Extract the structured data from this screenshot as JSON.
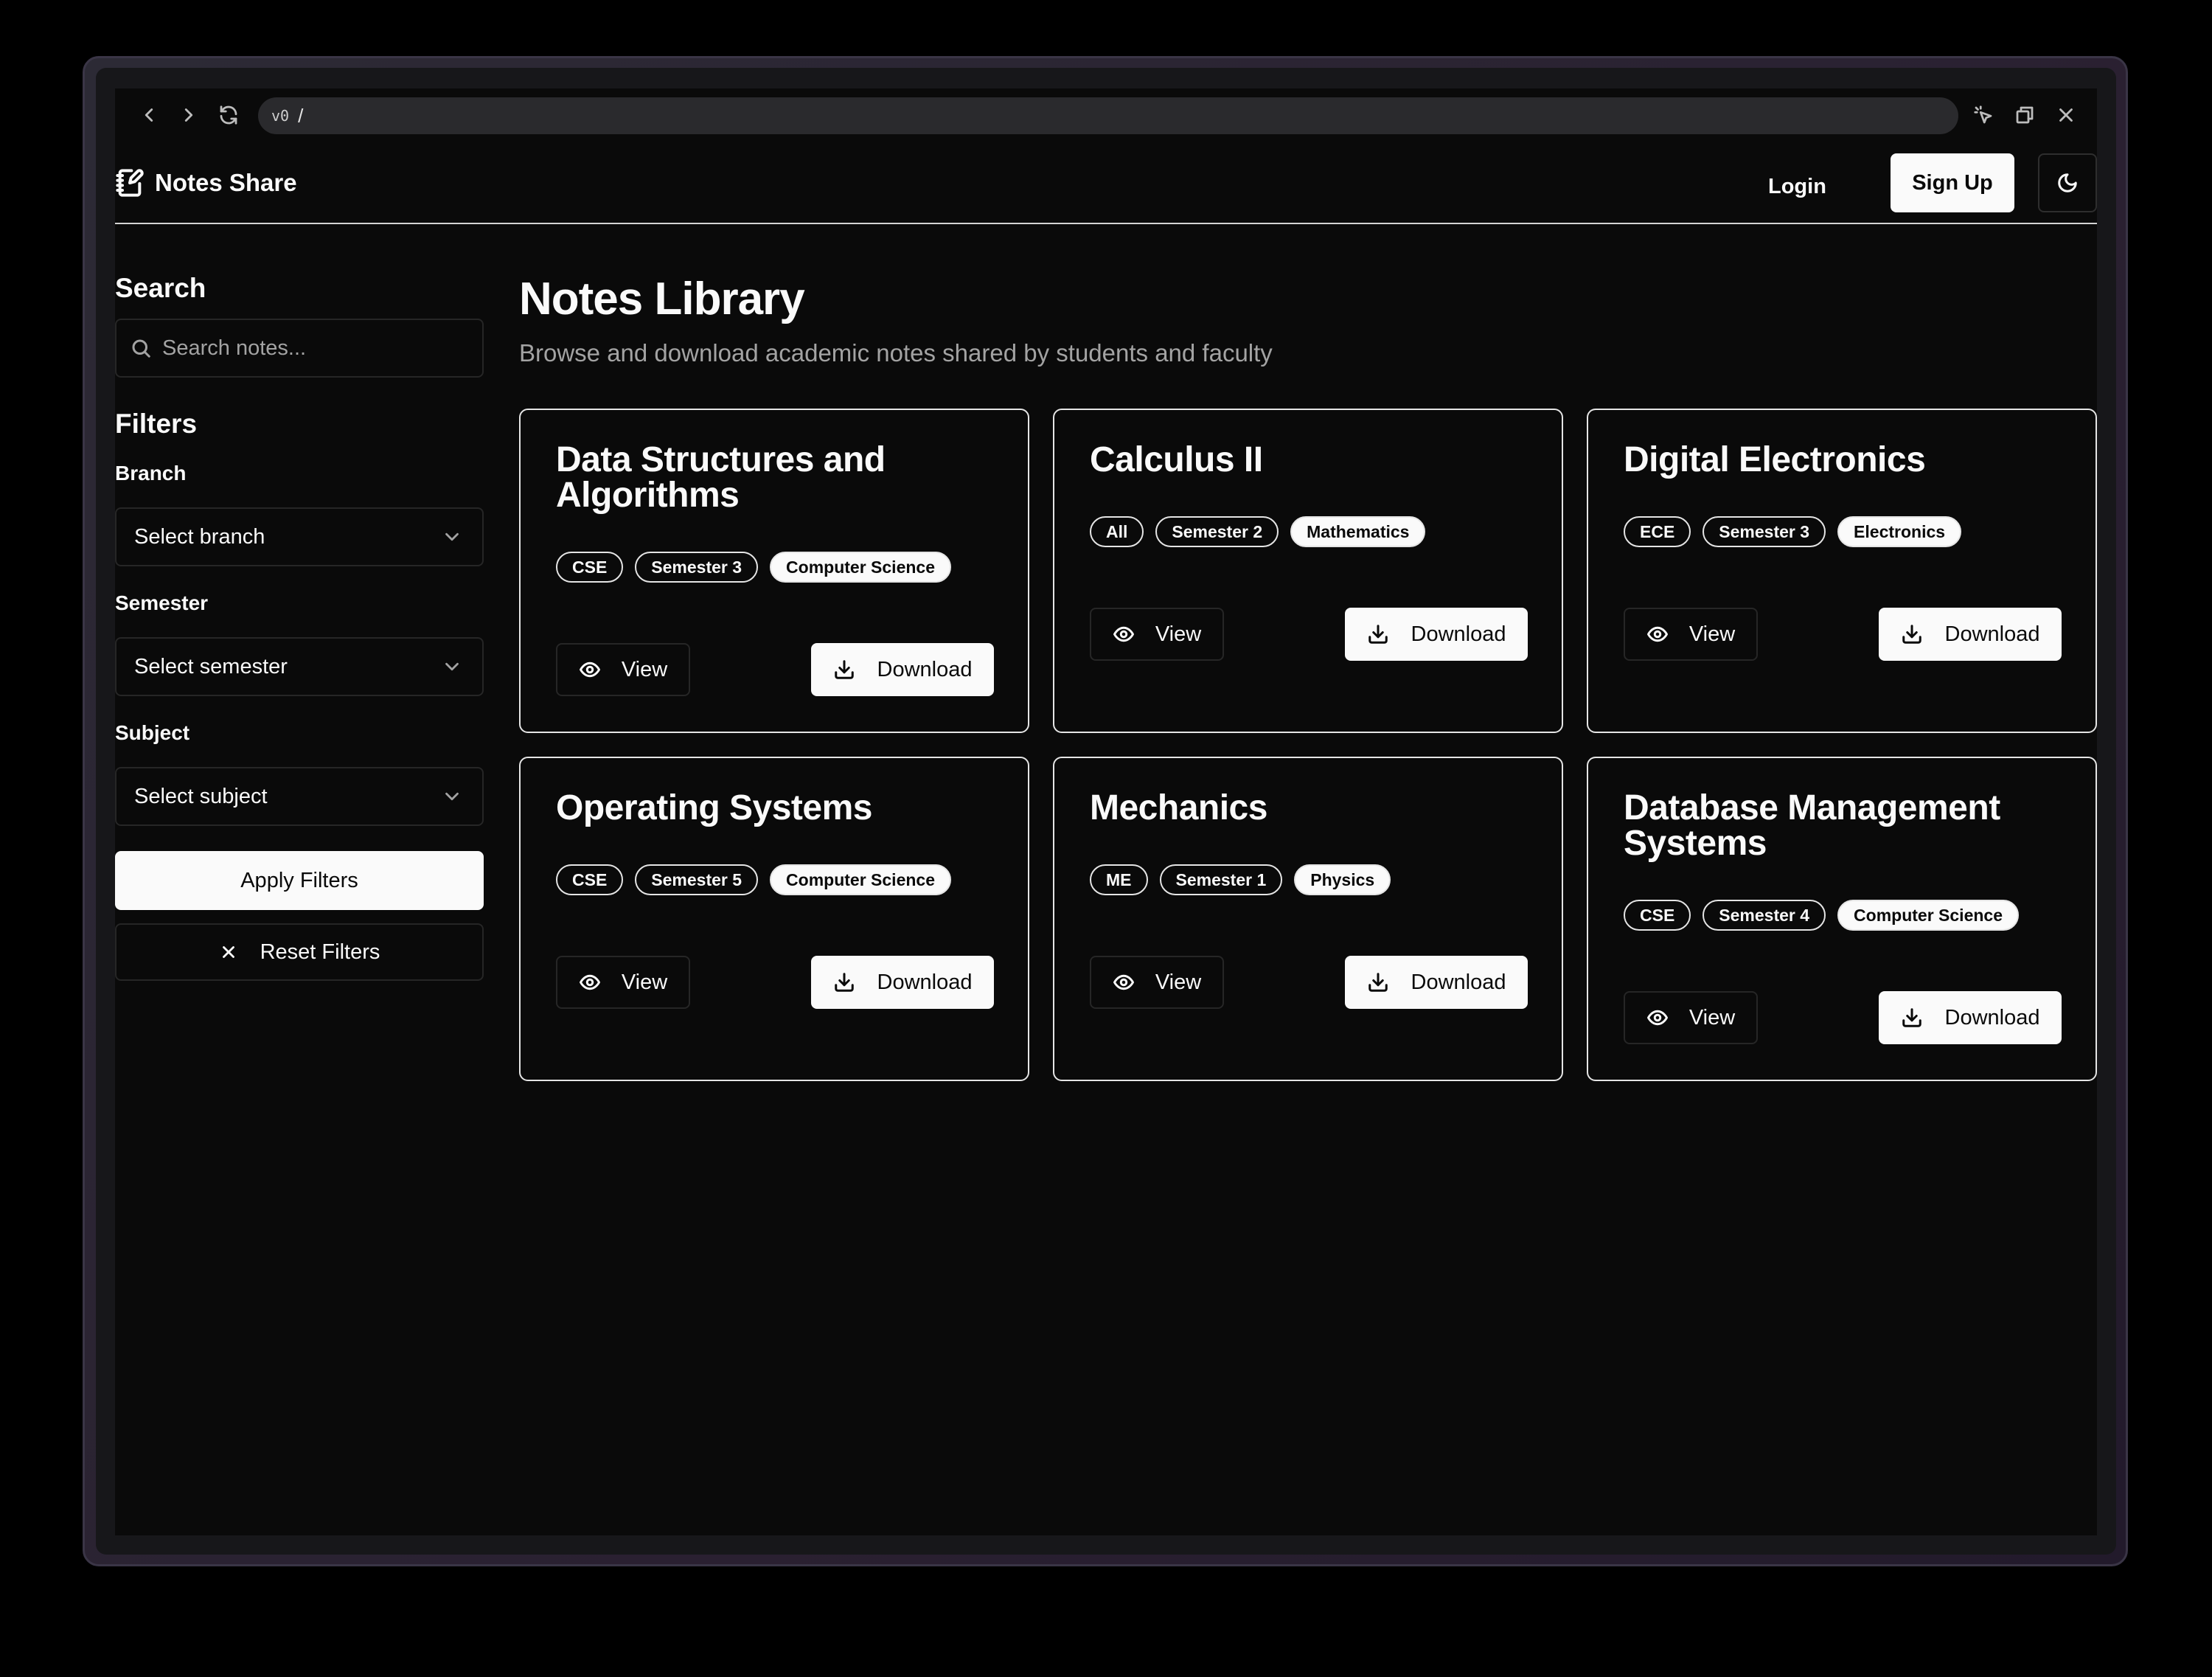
{
  "browser": {
    "url_prefix": "v0",
    "url": "/"
  },
  "header": {
    "brand": "Notes Share",
    "login": "Login",
    "signup": "Sign Up"
  },
  "sidebar": {
    "search_heading": "Search",
    "search_placeholder": "Search notes...",
    "filters_heading": "Filters",
    "branch_label": "Branch",
    "branch_value": "Select branch",
    "semester_label": "Semester",
    "semester_value": "Select semester",
    "subject_label": "Subject",
    "subject_value": "Select subject",
    "apply": "Apply Filters",
    "reset": "Reset Filters"
  },
  "main": {
    "title": "Notes Library",
    "subtitle": "Browse and download academic notes shared by students and faculty",
    "view_label": "View",
    "download_label": "Download",
    "cards": [
      {
        "title": "Data Structures and Algorithms",
        "branch": "CSE",
        "semester": "Semester 3",
        "subject": "Computer Science"
      },
      {
        "title": "Calculus II",
        "branch": "All",
        "semester": "Semester 2",
        "subject": "Mathematics"
      },
      {
        "title": "Digital Electronics",
        "branch": "ECE",
        "semester": "Semester 3",
        "subject": "Electronics"
      },
      {
        "title": "Operating Systems",
        "branch": "CSE",
        "semester": "Semester 5",
        "subject": "Computer Science"
      },
      {
        "title": "Mechanics",
        "branch": "ME",
        "semester": "Semester 1",
        "subject": "Physics"
      },
      {
        "title": "Database Management Systems",
        "branch": "CSE",
        "semester": "Semester 4",
        "subject": "Computer Science"
      }
    ]
  },
  "icons": {
    "brand": "notebook-pen-icon",
    "theme": "moon-icon",
    "search": "search-icon",
    "select": "chevron-down-icon",
    "reset": "x-icon",
    "view": "eye-icon",
    "download": "download-icon"
  },
  "colors": {
    "background": "#0a0a0a",
    "foreground": "#fafafa",
    "muted": "#a3a3a3",
    "border": "#262626"
  }
}
